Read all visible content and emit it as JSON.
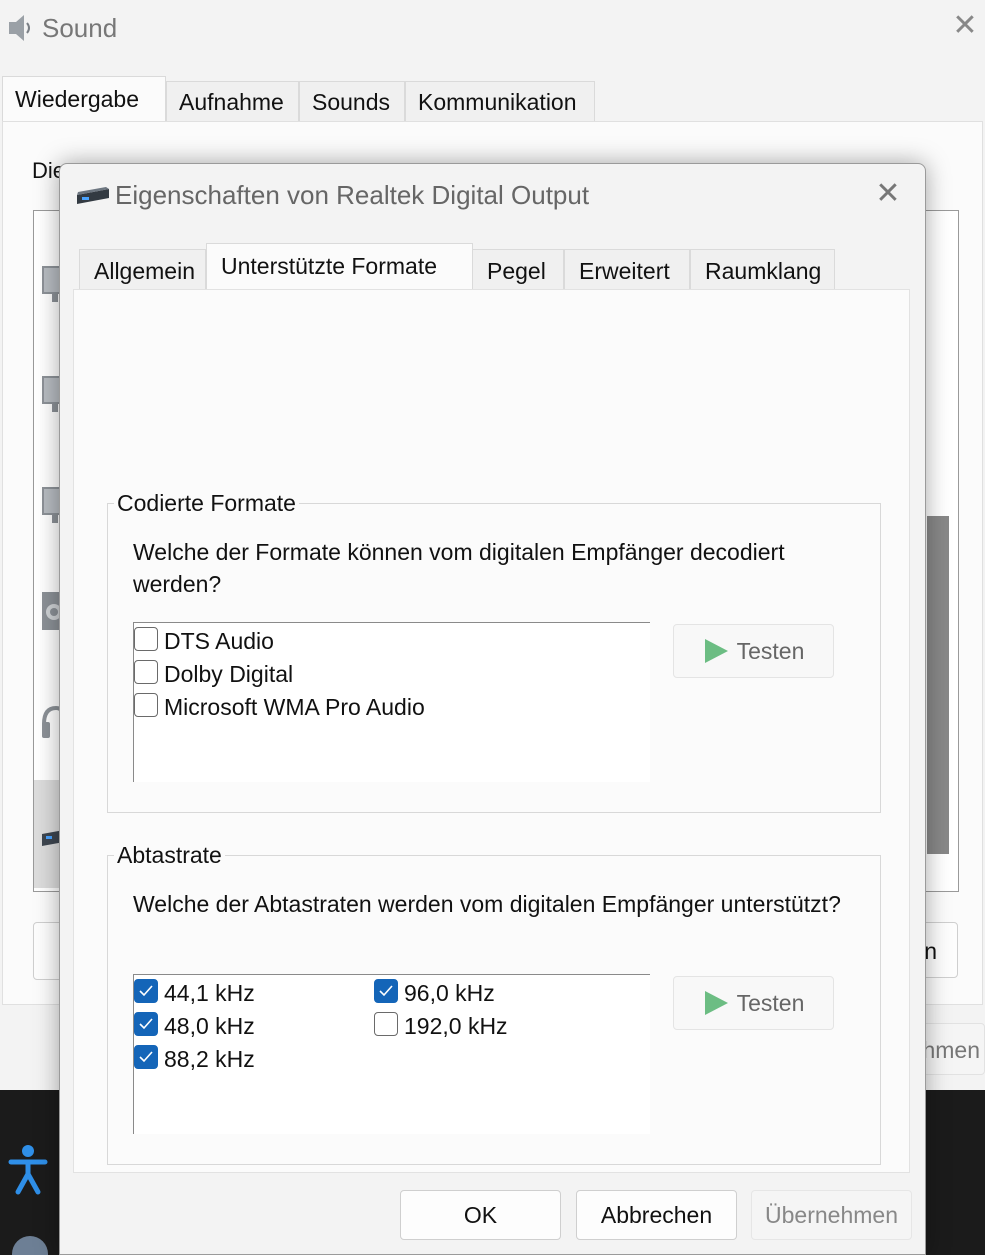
{
  "outer_window": {
    "title": "Sound",
    "tabs": [
      {
        "label": "Wiedergabe",
        "active": true
      },
      {
        "label": "Aufnahme",
        "active": false
      },
      {
        "label": "Sounds",
        "active": false
      },
      {
        "label": "Kommunikation",
        "active": false
      }
    ],
    "description_partial": "Die",
    "right_button_partial": "n",
    "apply_partial": "hmen"
  },
  "dialog": {
    "title": "Eigenschaften von Realtek Digital Output",
    "tabs": [
      {
        "label": "Allgemein",
        "active": false
      },
      {
        "label": "Unterstützte Formate",
        "active": true
      },
      {
        "label": "Pegel",
        "active": false
      },
      {
        "label": "Erweitert",
        "active": false
      },
      {
        "label": "Raumklang",
        "active": false
      }
    ],
    "encoded": {
      "legend": "Codierte Formate",
      "description": "Welche der Formate können vom digitalen Empfänger decodiert werden?",
      "items": [
        {
          "label": "DTS Audio",
          "checked": false
        },
        {
          "label": "Dolby Digital",
          "checked": false
        },
        {
          "label": "Microsoft WMA Pro Audio",
          "checked": false
        }
      ],
      "test_label": "Testen"
    },
    "sample_rate": {
      "legend": "Abtastrate",
      "description": "Welche der Abtastraten werden vom digitalen Empfänger unterstützt?",
      "column1": [
        {
          "label": "44,1 kHz",
          "checked": true
        },
        {
          "label": "48,0 kHz",
          "checked": true
        },
        {
          "label": "88,2 kHz",
          "checked": true
        }
      ],
      "column2": [
        {
          "label": "96,0 kHz",
          "checked": true
        },
        {
          "label": "192,0 kHz",
          "checked": false
        }
      ],
      "test_label": "Testen"
    },
    "buttons": {
      "ok": "OK",
      "cancel": "Abbrechen",
      "apply": "Übernehmen"
    }
  },
  "colors": {
    "accent": "#1465b8",
    "play_icon": "#3daa5c"
  }
}
